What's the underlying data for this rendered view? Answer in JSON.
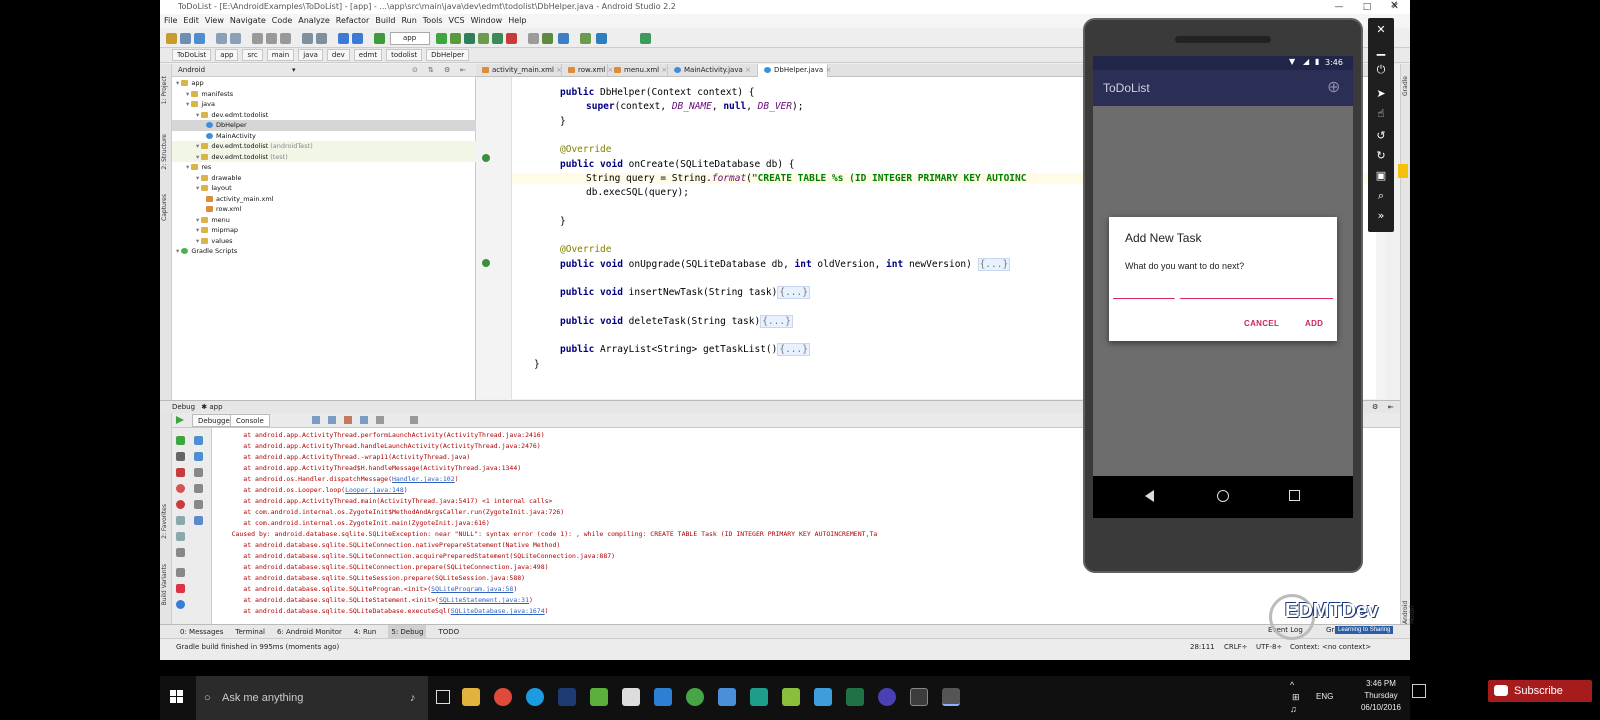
{
  "window": {
    "title": "ToDoList - [E:\\AndroidExamples\\ToDoList] - [app] - ...\\app\\src\\main\\java\\dev\\edmt\\todolist\\DbHelper.java - Android Studio 2.2",
    "minimize": "—",
    "maximize": "□",
    "close": "✕"
  },
  "menu": [
    "File",
    "Edit",
    "View",
    "Navigate",
    "Code",
    "Analyze",
    "Refactor",
    "Build",
    "Run",
    "Tools",
    "VCS",
    "Window",
    "Help"
  ],
  "toolbar": {
    "run_config": "app"
  },
  "breadcrumb": [
    "ToDoList",
    "app",
    "src",
    "main",
    "java",
    "dev",
    "edmt",
    "todolist",
    "DbHelper"
  ],
  "left_strip": [
    "1: Project",
    "2: Structure",
    "Captures",
    "2: Favorites",
    "Build Variants"
  ],
  "right_strip": [
    "Gradle",
    "Android Model"
  ],
  "project": {
    "view": "Android",
    "tree": [
      {
        "label": "app",
        "indent": 0,
        "icon": "folder"
      },
      {
        "label": "manifests",
        "indent": 1,
        "icon": "folder"
      },
      {
        "label": "java",
        "indent": 1,
        "icon": "folder"
      },
      {
        "label": "dev.edmt.todolist",
        "indent": 2,
        "icon": "folder"
      },
      {
        "label": "DbHelper",
        "indent": 3,
        "icon": "java",
        "selected": true
      },
      {
        "label": "MainActivity",
        "indent": 3,
        "icon": "java"
      },
      {
        "label": "dev.edmt.todolist",
        "suffix": " (androidTest)",
        "indent": 2,
        "icon": "folder",
        "hl": true
      },
      {
        "label": "dev.edmt.todolist",
        "suffix": " (test)",
        "indent": 2,
        "icon": "folder",
        "hl": true
      },
      {
        "label": "res",
        "indent": 1,
        "icon": "folder"
      },
      {
        "label": "drawable",
        "indent": 2,
        "icon": "folder"
      },
      {
        "label": "layout",
        "indent": 2,
        "icon": "folder"
      },
      {
        "label": "activity_main.xml",
        "indent": 3,
        "icon": "xml"
      },
      {
        "label": "row.xml",
        "indent": 3,
        "icon": "xml"
      },
      {
        "label": "menu",
        "indent": 2,
        "icon": "folder"
      },
      {
        "label": "mipmap",
        "indent": 2,
        "icon": "folder"
      },
      {
        "label": "values",
        "indent": 2,
        "icon": "folder"
      },
      {
        "label": "Gradle Scripts",
        "indent": 0,
        "icon": "gradle"
      }
    ]
  },
  "editor_tabs": [
    "activity_main.xml",
    "row.xml",
    "menu.xml",
    "MainActivity.java",
    "DbHelper.java"
  ],
  "code": [
    {
      "indent": 1,
      "parts": [
        [
          "kw",
          "public "
        ],
        [
          "",
          "DbHelper(Context context) {"
        ]
      ]
    },
    {
      "indent": 2,
      "parts": [
        [
          "kw",
          "super"
        ],
        [
          "",
          "(context, "
        ],
        [
          "ital",
          "DB_NAME"
        ],
        [
          "",
          ", "
        ],
        [
          "kw",
          "null"
        ],
        [
          "",
          ", "
        ],
        [
          "ital",
          "DB_VER"
        ],
        [
          "",
          ");"
        ]
      ]
    },
    {
      "indent": 1,
      "parts": [
        [
          "",
          "}"
        ]
      ]
    },
    {
      "indent": 0,
      "parts": [
        [
          "",
          ""
        ]
      ]
    },
    {
      "indent": 1,
      "parts": [
        [
          "ann",
          "@Override"
        ]
      ]
    },
    {
      "indent": 1,
      "parts": [
        [
          "kw",
          "public void "
        ],
        [
          "",
          "onCreate(SQLiteDatabase db) {"
        ]
      ]
    },
    {
      "indent": 2,
      "parts": [
        [
          "",
          "String query = String."
        ],
        [
          "ital",
          "format"
        ],
        [
          "",
          "("
        ],
        [
          "str",
          "\"CREATE TABLE %s (ID INTEGER PRIMARY KEY AUTOINC"
        ]
      ],
      "caret": true
    },
    {
      "indent": 2,
      "parts": [
        [
          "",
          "db.execSQL(query);"
        ]
      ]
    },
    {
      "indent": 0,
      "parts": [
        [
          "",
          ""
        ]
      ]
    },
    {
      "indent": 1,
      "parts": [
        [
          "",
          "}"
        ]
      ]
    },
    {
      "indent": 0,
      "parts": [
        [
          "",
          ""
        ]
      ]
    },
    {
      "indent": 1,
      "parts": [
        [
          "ann",
          "@Override"
        ]
      ]
    },
    {
      "indent": 1,
      "parts": [
        [
          "kw",
          "public void "
        ],
        [
          "",
          "onUpgrade(SQLiteDatabase db, "
        ],
        [
          "kw",
          "int "
        ],
        [
          "",
          "oldVersion, "
        ],
        [
          "kw",
          "int "
        ],
        [
          "",
          "newVersion) "
        ],
        [
          "fold",
          "{...}"
        ]
      ]
    },
    {
      "indent": 0,
      "parts": [
        [
          "",
          ""
        ]
      ]
    },
    {
      "indent": 1,
      "parts": [
        [
          "kw",
          "public void "
        ],
        [
          "",
          "insertNewTask(String task)"
        ],
        [
          "fold",
          "{...}"
        ]
      ]
    },
    {
      "indent": 0,
      "parts": [
        [
          "",
          ""
        ]
      ]
    },
    {
      "indent": 1,
      "parts": [
        [
          "kw",
          "public void "
        ],
        [
          "",
          "deleteTask(String task)"
        ],
        [
          "fold",
          "{...}"
        ]
      ]
    },
    {
      "indent": 0,
      "parts": [
        [
          "",
          ""
        ]
      ]
    },
    {
      "indent": 1,
      "parts": [
        [
          "kw",
          "public "
        ],
        [
          "",
          "ArrayList<String> getTaskList()"
        ],
        [
          "fold",
          "{...}"
        ]
      ]
    },
    {
      "indent": 0,
      "parts": [
        [
          "",
          "}"
        ]
      ]
    }
  ],
  "debug": {
    "title": "Debug",
    "config": "app",
    "tabs": [
      "Debugger",
      "Console"
    ]
  },
  "console": [
    {
      "text": "        at android.app.ActivityThread.performLaunchActivity(ActivityThread.java:2416)",
      "link": ""
    },
    {
      "text": "        at android.app.ActivityThread.handleLaunchActivity(ActivityThread.java:2476)",
      "link": ""
    },
    {
      "text": "        at android.app.ActivityThread.-wrap11(ActivityThread.java)",
      "link": ""
    },
    {
      "text": "        at android.app.ActivityThread$H.handleMessage(ActivityThread.java:1344)",
      "link": ""
    },
    {
      "text": "        at android.os.Handler.dispatchMessage(",
      "link": "Handler.java:102",
      "tail": ")"
    },
    {
      "text": "        at android.os.Looper.loop(",
      "link": "Looper.java:148",
      "tail": ")"
    },
    {
      "text": "        at android.app.ActivityThread.main(ActivityThread.java:5417) <1 internal calls>",
      "link": ""
    },
    {
      "text": "        at com.android.internal.os.ZygoteInit$MethodAndArgsCaller.run(ZygoteInit.java:726)",
      "link": ""
    },
    {
      "text": "        at com.android.internal.os.ZygoteInit.main(ZygoteInit.java:616)",
      "link": ""
    },
    {
      "text": "     Caused by: android.database.sqlite.SQLiteException: near \"NULL\": syntax error (code 1): , while compiling: CREATE TABLE Task (ID INTEGER PRIMARY KEY AUTOINCREMENT,Ta",
      "link": ""
    },
    {
      "text": "        at android.database.sqlite.SQLiteConnection.nativePrepareStatement(Native Method)",
      "link": ""
    },
    {
      "text": "        at android.database.sqlite.SQLiteConnection.acquirePreparedStatement(SQLiteConnection.java:887)",
      "link": ""
    },
    {
      "text": "        at android.database.sqlite.SQLiteConnection.prepare(SQLiteConnection.java:498)",
      "link": ""
    },
    {
      "text": "        at android.database.sqlite.SQLiteSession.prepare(SQLiteSession.java:588)",
      "link": ""
    },
    {
      "text": "        at android.database.sqlite.SQLiteProgram.<init>(",
      "link": "SQLiteProgram.java:58",
      "tail": ")"
    },
    {
      "text": "        at android.database.sqlite.SQLiteStatement.<init>(",
      "link": "SQLiteStatement.java:31",
      "tail": ")"
    },
    {
      "text": "        at android.database.sqlite.SQLiteDatabase.executeSql(",
      "link": "SQLiteDatabase.java:1674",
      "tail": ")"
    }
  ],
  "bottom_tabs": [
    "0: Messages",
    "Terminal",
    "6: Android Monitor",
    "4: Run",
    "5: Debug",
    "TODO"
  ],
  "status": {
    "message": "Gradle build finished in 995ms (moments ago)",
    "position": "28:111",
    "line_sep": "CRLF÷",
    "encoding": "UTF-8÷",
    "context": "Context: <no context>",
    "event_log": "Event Log",
    "gradle_console": "Gradle Console"
  },
  "emulator": {
    "time": "3:46",
    "app_title": "ToDoList",
    "dialog": {
      "title": "Add New Task",
      "message": "What do you want to do next?",
      "input_value": "",
      "cancel": "CANCEL",
      "add": "ADD"
    }
  },
  "logo": {
    "main": "EDMTDev",
    "tagline": "Learning to Sharing"
  },
  "taskbar": {
    "search_placeholder": "Ask me anything",
    "lang": "ENG",
    "time": "3:46 PM",
    "day": "Thursday",
    "date": "06/10/2016"
  },
  "subscribe": "Subscribe",
  "colors": {
    "accent": "#e0245e",
    "appbar": "#2b2e55",
    "error_text": "#b00000"
  }
}
